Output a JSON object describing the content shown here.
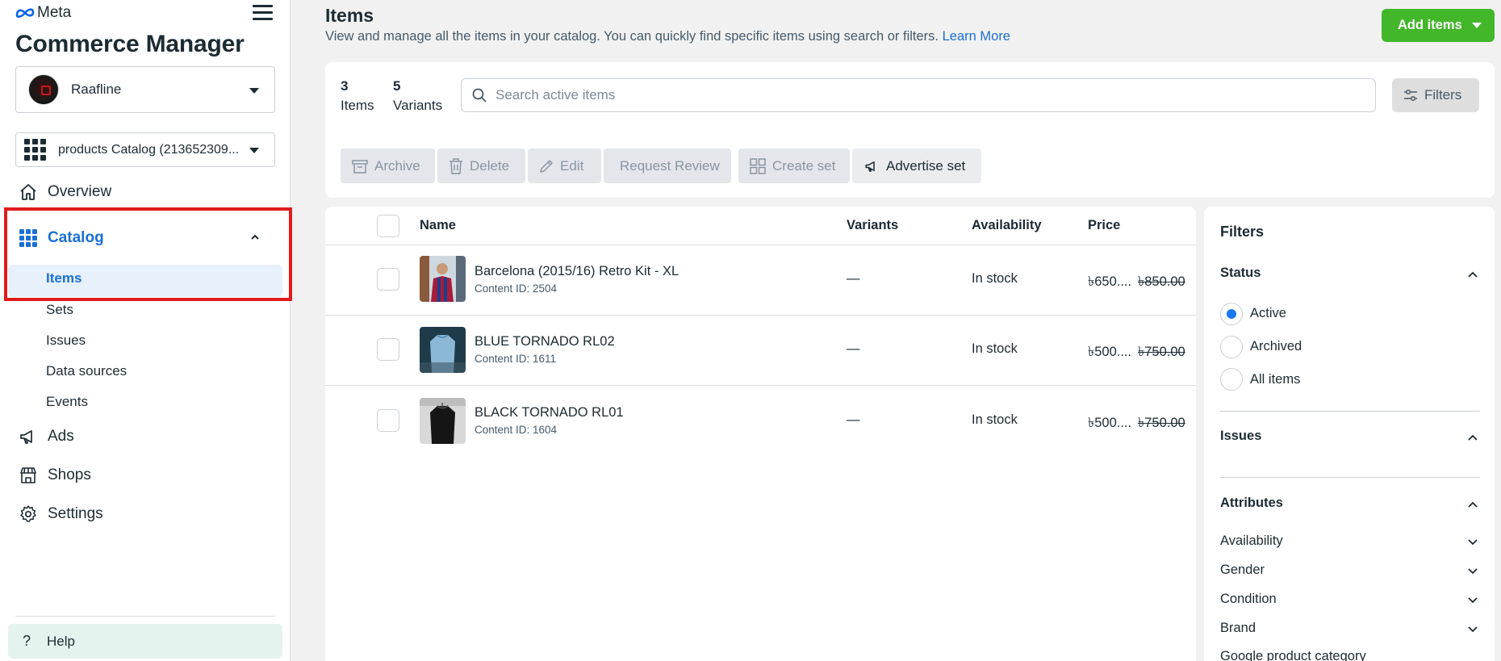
{
  "brand": {
    "logo_text": "Meta",
    "app_title": "Commerce Manager"
  },
  "account": {
    "name": "Raafline"
  },
  "catalog": {
    "name": "products Catalog (213652309..."
  },
  "nav": {
    "overview": "Overview",
    "catalog": "Catalog",
    "catalog_sub": [
      "Items",
      "Sets",
      "Issues",
      "Data sources",
      "Events"
    ],
    "ads": "Ads",
    "shops": "Shops",
    "settings": "Settings",
    "help": "Help"
  },
  "header": {
    "title": "Items",
    "description": "View and manage all the items in your catalog. You can quickly find specific items using search or filters.",
    "learn_more": "Learn More",
    "add_button": "Add items"
  },
  "summary": {
    "items_count": "3",
    "items_label": "Items",
    "variants_count": "5",
    "variants_label": "Variants"
  },
  "search": {
    "placeholder": "Search active items"
  },
  "filters_button": "Filters",
  "actions": [
    "Archive",
    "Delete",
    "Edit",
    "Request Review",
    "Create set",
    "Advertise set"
  ],
  "table": {
    "columns": [
      "Name",
      "Variants",
      "Availability",
      "Price"
    ],
    "rows": [
      {
        "name": "Barcelona (2015/16) Retro Kit - XL",
        "content_id": "Content ID: 2504",
        "variants": "—",
        "availability": "In stock",
        "price": "৳650....",
        "original_price": "৳850.00"
      },
      {
        "name": "BLUE TORNADO RL02",
        "content_id": "Content ID: 1611",
        "variants": "—",
        "availability": "In stock",
        "price": "৳500....",
        "original_price": "৳750.00"
      },
      {
        "name": "BLACK TORNADO RL01",
        "content_id": "Content ID: 1604",
        "variants": "—",
        "availability": "In stock",
        "price": "৳500....",
        "original_price": "৳750.00"
      }
    ]
  },
  "filters_panel": {
    "title": "Filters",
    "status": {
      "label": "Status",
      "options": [
        "Active",
        "Archived",
        "All items"
      ],
      "selected": "Active"
    },
    "issues": {
      "label": "Issues"
    },
    "attributes": {
      "label": "Attributes",
      "items": [
        "Availability",
        "Gender",
        "Condition",
        "Brand",
        "Google product category"
      ]
    }
  },
  "colors": {
    "accent": "#1a6fd6",
    "add_button": "#42b72a",
    "highlight": "#e01b1b",
    "selected_bg": "#e7f0fb",
    "help_bg": "#e4f3ee"
  }
}
